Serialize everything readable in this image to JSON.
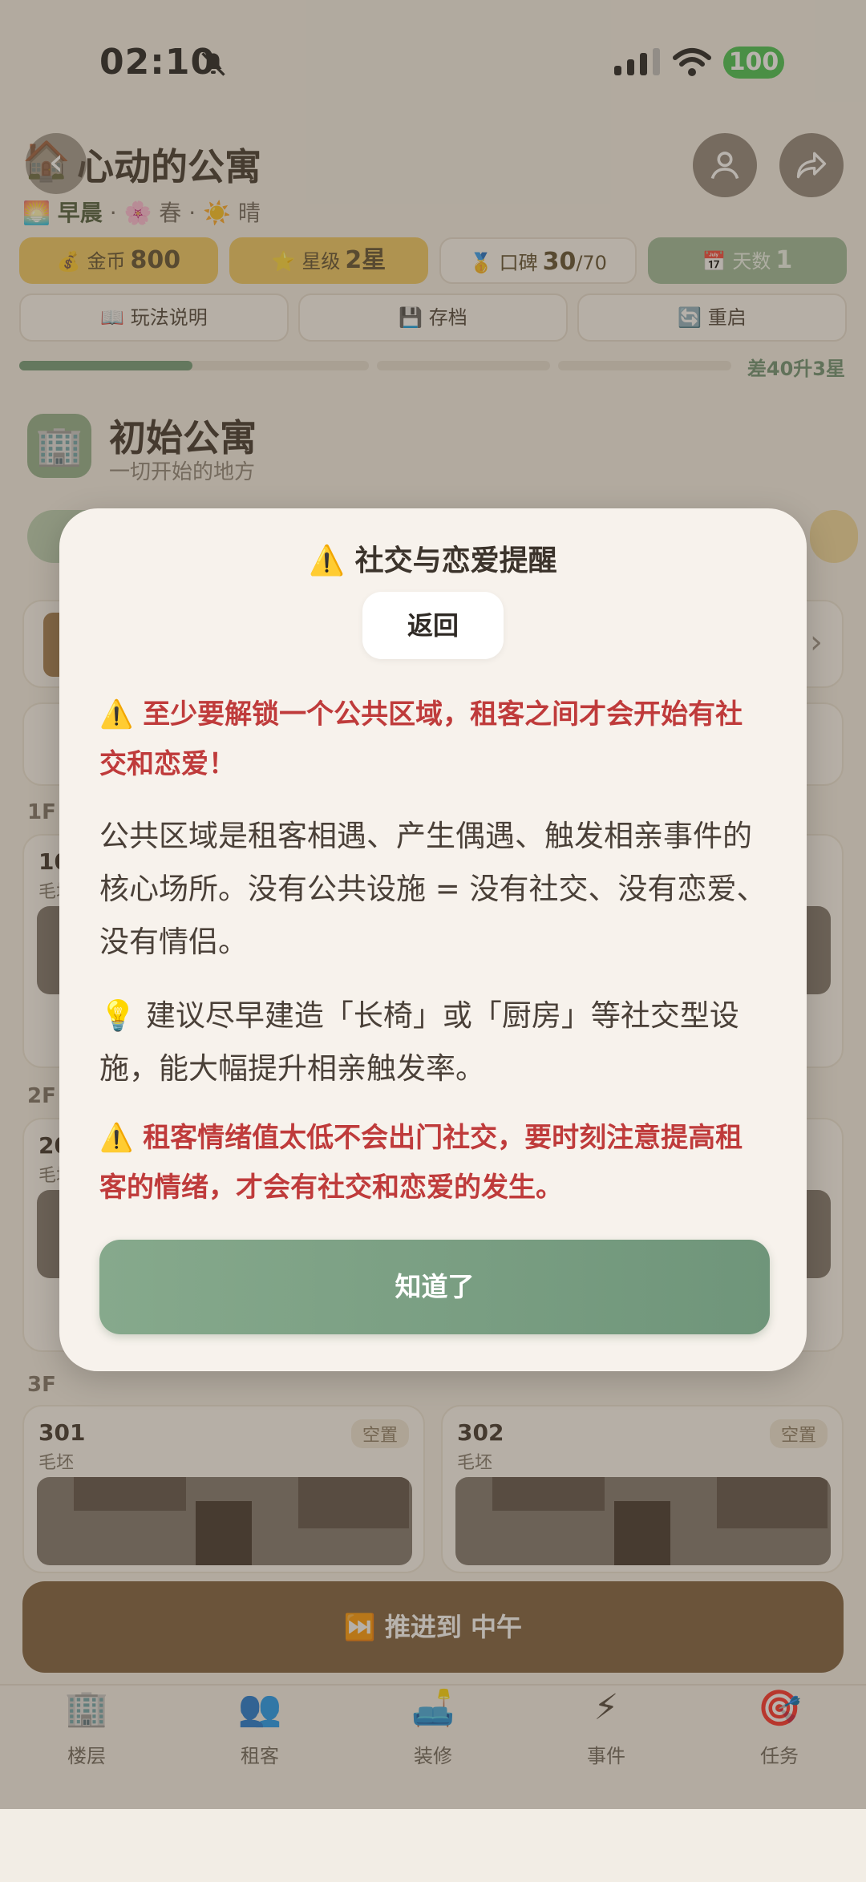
{
  "status": {
    "time": "02:10",
    "battery": "100"
  },
  "header": {
    "title_icon": "🏠",
    "title": "心动的公寓",
    "time_of_day_icon": "🌅",
    "time_of_day": "早晨",
    "season_icon": "🌸",
    "season": "春",
    "weather_icon": "☀️",
    "weather": "晴",
    "separator": "·"
  },
  "stats": {
    "coins": {
      "icon": "💰",
      "label": "金币",
      "value": "800"
    },
    "stars": {
      "icon": "⭐",
      "label": "星级",
      "value": "2星"
    },
    "reputation": {
      "icon": "🥇",
      "label": "口碑",
      "value": "30",
      "max": "/70"
    },
    "day": {
      "icon": "📅",
      "label": "天数",
      "value": "1"
    }
  },
  "actions": {
    "guide": {
      "icon": "📖",
      "label": "玩法说明"
    },
    "save": {
      "icon": "💾",
      "label": "存档"
    },
    "restart": {
      "icon": "🔄",
      "label": "重启"
    }
  },
  "progress": {
    "fraction": 0.3,
    "note": "差40升3星"
  },
  "building": {
    "icon": "🏢",
    "name": "初始公寓",
    "subtitle": "一切开始的地方"
  },
  "floors": [
    {
      "label": "1F",
      "rooms": [
        {
          "no": "10",
          "type": "毛坯"
        }
      ]
    },
    {
      "label": "2F",
      "rooms": [
        {
          "no": "20",
          "type": "毛坯"
        }
      ]
    },
    {
      "label": "3F",
      "rooms": [
        {
          "no": "301",
          "type": "毛坯",
          "tag": "空置"
        },
        {
          "no": "302",
          "type": "毛坯",
          "tag": "空置"
        }
      ]
    }
  ],
  "advance_button": {
    "icon": "⏭️",
    "label": "推进到 中午"
  },
  "tabs": [
    {
      "icon": "🏢",
      "label": "楼层"
    },
    {
      "icon": "👥",
      "label": "租客"
    },
    {
      "icon": "🛋️",
      "label": "装修"
    },
    {
      "icon": "⚡",
      "label": "事件"
    },
    {
      "icon": "🎯",
      "label": "任务"
    }
  ],
  "modal": {
    "title_icon": "⚠️",
    "title": "社交与恋爱提醒",
    "back_label": "返回",
    "warning1_icon": "⚠️",
    "warning1": "至少要解锁一个公共区域，租客之间才会开始有社交和恋爱！",
    "body1": "公共区域是租客相遇、产生偶遇、触发相亲事件的核心场所。没有公共设施 = 没有社交、没有恋爱、没有情侣。",
    "tip_icon": "💡",
    "tip": "建议尽早建造「长椅」或「厨房」等社交型设施，能大幅提升相亲触发率。",
    "warning2_icon": "⚠️",
    "warning2": "租客情绪值太低不会出门社交，要时刻注意提高租客的情绪，才会有社交和恋爱的发生。",
    "ok_label": "知道了"
  }
}
